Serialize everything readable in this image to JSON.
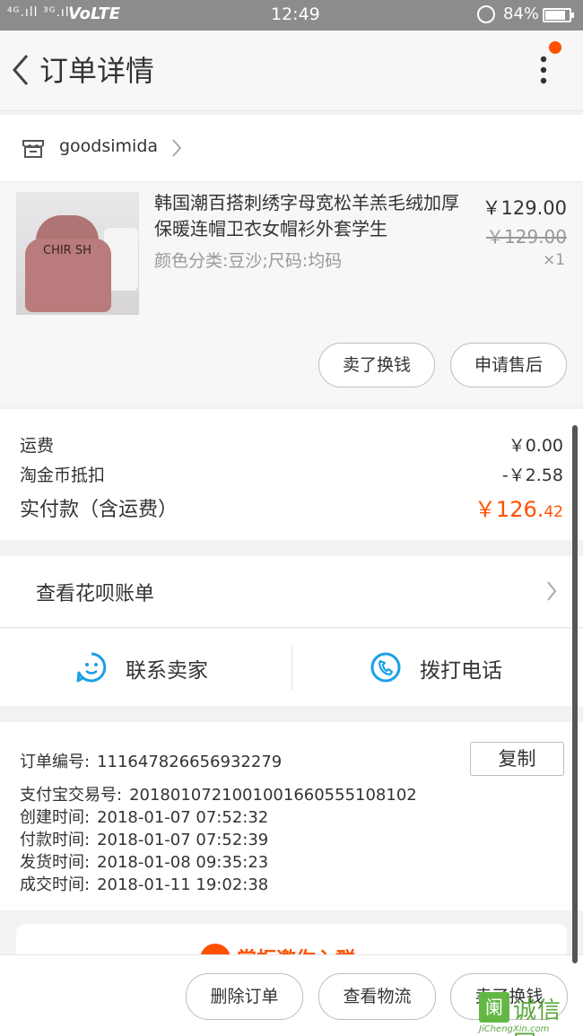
{
  "status_bar": {
    "signal": "⁴ᴳ.ıll ³ᴳ.ıll",
    "network": "VoLTE",
    "time": "12:49",
    "battery_pct": "84%",
    "battery_level": 0.84
  },
  "header": {
    "title": "订单详情"
  },
  "shop": {
    "name": "goodsimida"
  },
  "item": {
    "title": "韩国潮百搭刺绣字母宽松羊羔毛绒加厚保暖连帽卫衣女帽衫外套学生",
    "spec": "颜色分类:豆沙;尺码:均码",
    "price": "￥129.00",
    "original_price": "￥129.00",
    "quantity": "×1",
    "thumb_text": "CHIR SH",
    "buttons": {
      "sell": "卖了换钱",
      "after_sale": "申请售后"
    }
  },
  "costs": {
    "shipping_label": "运费",
    "shipping_value": "￥0.00",
    "coin_label": "淘金币抵扣",
    "coin_value": "-￥2.58",
    "paid_label": "实付款（含运费）",
    "paid_value_main": "￥126.",
    "paid_value_cents": "42"
  },
  "huabei": {
    "label": "查看花呗账单"
  },
  "contact": {
    "seller": "联系卖家",
    "call": "拨打电话"
  },
  "order_info": {
    "order_no_label": "订单编号:",
    "order_no": "111647826656932279",
    "copy_label": "复制",
    "alipay_label": "支付宝交易号:",
    "alipay_no": "2018010721001001660555108102",
    "created_label": "创建时间:",
    "created": "2018-01-07  07:52:32",
    "paid_label": "付款时间:",
    "paid": "2018-01-07  07:52:39",
    "shipped_label": "发货时间:",
    "shipped": "2018-01-08  09:35:23",
    "closed_label": "成交时间:",
    "closed": "2018-01-11  19:02:38"
  },
  "promo_card": {
    "text": "掌柜邀你入群"
  },
  "bottom_bar": {
    "delete": "删除订单",
    "logistics": "查看物流",
    "sell": "卖了换钱"
  },
  "watermark": {
    "mark": "阑",
    "big": "诚信网",
    "small": "JiChengXin.com"
  },
  "colors": {
    "accent": "#ff5000",
    "link_blue": "#1aa0e6",
    "watermark_green": "#5aa83f"
  }
}
